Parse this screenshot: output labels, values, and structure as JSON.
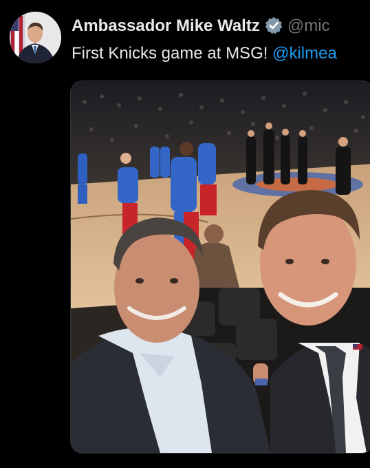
{
  "tweet": {
    "author_name": "Ambassador Mike Waltz",
    "author_handle": "@mic",
    "text_prefix": "First Knicks game at MSG! ",
    "mention": "@kilmea",
    "verified_icon": "verified-badge-icon"
  },
  "colors": {
    "background": "#000000",
    "text": "#e7e9ea",
    "handle": "#71767b",
    "mention": "#1d9bf0"
  }
}
